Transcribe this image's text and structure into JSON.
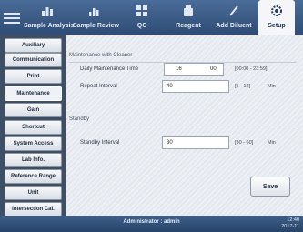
{
  "toolbar": {
    "tabs": [
      {
        "label": "Sample Analysis",
        "icon": "bar-chart-icon"
      },
      {
        "label": "Sample Review",
        "icon": "chart-review-icon"
      },
      {
        "label": "QC",
        "icon": "qc-grid-icon"
      },
      {
        "label": "Reagent",
        "icon": "reagent-bottle-icon"
      },
      {
        "label": "Add Diluent",
        "icon": "pipette-icon"
      },
      {
        "label": "Setup",
        "icon": "gear-icon"
      }
    ],
    "active_tab": "Setup"
  },
  "sidebar": {
    "items": [
      {
        "label": "Auxiliary"
      },
      {
        "label": "Communication"
      },
      {
        "label": "Print"
      },
      {
        "label": "Maintenance"
      },
      {
        "label": "Gain"
      },
      {
        "label": "Shortcut"
      },
      {
        "label": "System Access"
      },
      {
        "label": "Lab Info."
      },
      {
        "label": "Reference Range"
      },
      {
        "label": "Unit"
      },
      {
        "label": "Intersection Cal."
      }
    ],
    "active": "Maintenance"
  },
  "main": {
    "maintenance_section": {
      "title": "Maintenance with Cleaner",
      "daily_time_label": "Daily Maintenance Time",
      "daily_time_hour": "16",
      "daily_time_minute": "00",
      "daily_time_range": "[00:00 - 23:59]",
      "interval_label": "Repeat Interval",
      "interval_value": "40",
      "interval_range": "[5 - 12]",
      "interval_unit": "Min"
    },
    "standby_section": {
      "title": "Standby",
      "interval_label": "Standby Interval",
      "interval_value": "30",
      "interval_range": "[30 - 60]",
      "interval_unit": "Min"
    },
    "save_label": "Save"
  },
  "status": {
    "user": "Administrator : admin",
    "time": "12:40",
    "date": "2017-11"
  }
}
